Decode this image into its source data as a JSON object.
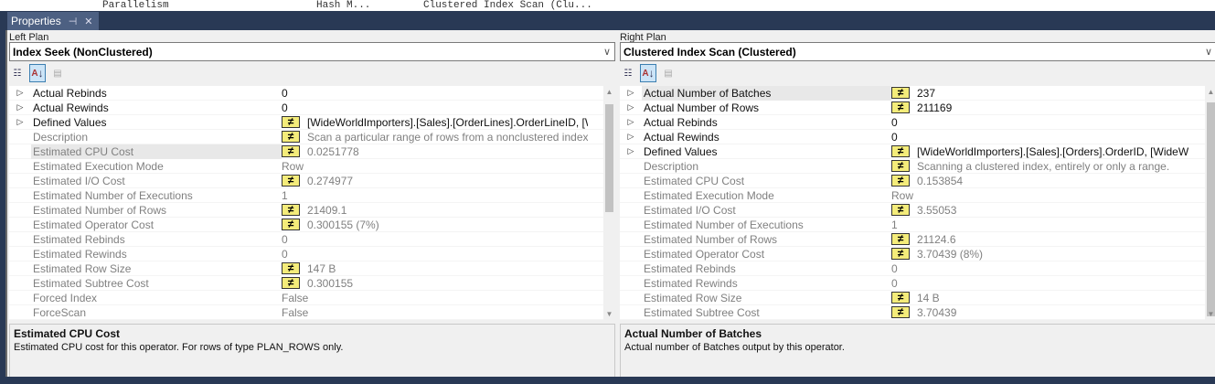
{
  "background_tabs": [
    "Parallelism",
    "Hash M...",
    "Clustered Index Scan (Clu..."
  ],
  "tab": {
    "title": "Properties",
    "pin_icon": "pin-icon",
    "close_icon": "close-icon"
  },
  "left": {
    "label": "Left Plan",
    "selected": "Index Seek (NonClustered)",
    "rows": [
      {
        "name": "Actual Rebinds",
        "value": "0",
        "expand": true,
        "icon": false,
        "bold": true
      },
      {
        "name": "Actual Rewinds",
        "value": "0",
        "expand": true,
        "icon": false,
        "bold": true
      },
      {
        "name": "Defined Values",
        "value": "[WideWorldImporters].[Sales].[OrderLines].OrderLineID, [WideWorldImporters]",
        "expand": true,
        "icon": true,
        "bold": true
      },
      {
        "name": "Description",
        "value": "Scan a particular range of rows from a nonclustered index.",
        "icon": true
      },
      {
        "name": "Estimated CPU Cost",
        "value": "0.0251778",
        "icon": true,
        "selected": true
      },
      {
        "name": "Estimated Execution Mode",
        "value": "Row"
      },
      {
        "name": "Estimated I/O Cost",
        "value": "0.274977",
        "icon": true
      },
      {
        "name": "Estimated Number of Executions",
        "value": "1"
      },
      {
        "name": "Estimated Number of Rows",
        "value": "21409.1",
        "icon": true
      },
      {
        "name": "Estimated Operator Cost",
        "value": "0.300155 (7%)",
        "icon": true
      },
      {
        "name": "Estimated Rebinds",
        "value": "0"
      },
      {
        "name": "Estimated Rewinds",
        "value": "0"
      },
      {
        "name": "Estimated Row Size",
        "value": "147 B",
        "icon": true
      },
      {
        "name": "Estimated Subtree Cost",
        "value": "0.300155",
        "icon": true
      },
      {
        "name": "Forced Index",
        "value": "False"
      },
      {
        "name": "ForceScan",
        "value": "False"
      }
    ],
    "desc_title": "Estimated CPU Cost",
    "desc_text": "Estimated CPU cost for this operator. For rows of type PLAN_ROWS only."
  },
  "right": {
    "label": "Right Plan",
    "selected": "Clustered Index Scan (Clustered)",
    "rows": [
      {
        "name": "Actual Number of Batches",
        "value": "237",
        "expand": true,
        "icon": true,
        "bold": true,
        "selected": true
      },
      {
        "name": "Actual Number of Rows",
        "value": "211169",
        "expand": true,
        "icon": true,
        "bold": true
      },
      {
        "name": "Actual Rebinds",
        "value": "0",
        "expand": true,
        "bold": true
      },
      {
        "name": "Actual Rewinds",
        "value": "0",
        "expand": true,
        "bold": true
      },
      {
        "name": "Defined Values",
        "value": "[WideWorldImporters].[Sales].[Orders].OrderID, [WideWorldImporters]",
        "expand": true,
        "icon": true,
        "bold": true
      },
      {
        "name": "Description",
        "value": "Scanning a clustered index, entirely or only a range.",
        "icon": true
      },
      {
        "name": "Estimated CPU Cost",
        "value": "0.153854",
        "icon": true
      },
      {
        "name": "Estimated Execution Mode",
        "value": "Row"
      },
      {
        "name": "Estimated I/O Cost",
        "value": "3.55053",
        "icon": true
      },
      {
        "name": "Estimated Number of Executions",
        "value": "1"
      },
      {
        "name": "Estimated Number of Rows",
        "value": "21124.6",
        "icon": true
      },
      {
        "name": "Estimated Operator Cost",
        "value": "3.70439 (8%)",
        "icon": true
      },
      {
        "name": "Estimated Rebinds",
        "value": "0"
      },
      {
        "name": "Estimated Rewinds",
        "value": "0"
      },
      {
        "name": "Estimated Row Size",
        "value": "14 B",
        "icon": true
      },
      {
        "name": "Estimated Subtree Cost",
        "value": "3.70439",
        "icon": true
      }
    ],
    "desc_title": "Actual Number of Batches",
    "desc_text": "Actual number of Batches output by this operator."
  },
  "colors": {
    "chrome": "#293955",
    "tab": "#4d6082",
    "diff_icon": "#f4ec7a"
  }
}
